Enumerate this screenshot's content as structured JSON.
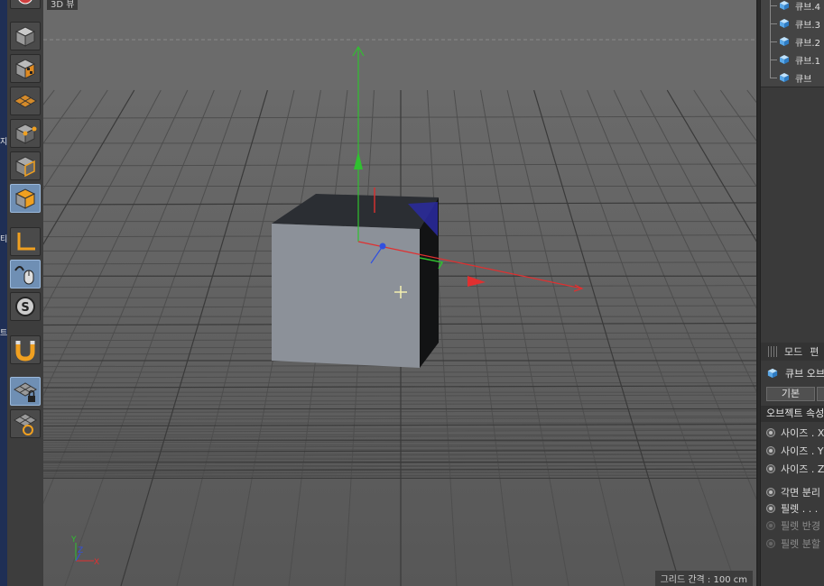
{
  "left_strip": {
    "glyphs": [
      "지",
      "티",
      "트"
    ]
  },
  "toolbar": {
    "tools": [
      {
        "name": "cube-tool",
        "icon": "cube-icon",
        "active": false
      },
      {
        "name": "checker-cube-tool",
        "icon": "checker-cube-icon",
        "active": false
      },
      {
        "name": "plane-tool",
        "icon": "plane-icon",
        "active": false
      },
      {
        "name": "point-mode-tool",
        "icon": "points-icon",
        "active": false
      },
      {
        "name": "edge-mode-tool",
        "icon": "edges-icon",
        "active": false
      },
      {
        "name": "polygon-mode-tool",
        "icon": "polygon-icon",
        "active": true
      },
      {
        "name": "axis-tool",
        "icon": "axis-icon",
        "active": false
      },
      {
        "name": "tweak-tool",
        "icon": "mouse-icon",
        "active": true
      },
      {
        "name": "snap-settings-tool",
        "icon": "s-icon",
        "active": false
      },
      {
        "name": "snap-magnet-tool",
        "icon": "magnet-icon",
        "active": false
      },
      {
        "name": "lock-workplane-tool",
        "icon": "grid-lock-icon",
        "active": true
      },
      {
        "name": "workplane-tool",
        "icon": "grid-refresh-icon",
        "active": false
      }
    ]
  },
  "viewport": {
    "view_label": "3D 뷰",
    "grid_spacing_label": "그리드 간격 : 100 cm",
    "axis_x": "X",
    "axis_y": "Y",
    "axis_z": "Z",
    "colors": {
      "x_axis": "#e03030",
      "y_axis": "#30c030",
      "z_axis": "#3050e0",
      "cube_front": "#8c9199",
      "cube_top": "#2b2e33",
      "cube_side": "#121314"
    }
  },
  "objects": {
    "items": [
      {
        "label": "큐브.4"
      },
      {
        "label": "큐브.3"
      },
      {
        "label": "큐브.2"
      },
      {
        "label": "큐브.1"
      },
      {
        "label": "큐브"
      }
    ]
  },
  "attributes": {
    "menu": [
      "모드",
      "편"
    ],
    "title": "큐브 오브",
    "tab": "기본",
    "section": "오브젝트 속성",
    "props": [
      {
        "label": "사이즈 . X",
        "dim": false
      },
      {
        "label": "사이즈 . Y",
        "dim": false
      },
      {
        "label": "사이즈 . Z",
        "dim": false
      },
      {
        "label": "각면 분리",
        "dim": false
      },
      {
        "label": "필렛 . . .",
        "dim": false
      },
      {
        "label": "필렛 반경",
        "dim": true
      },
      {
        "label": "필렛 분할",
        "dim": true
      }
    ]
  }
}
